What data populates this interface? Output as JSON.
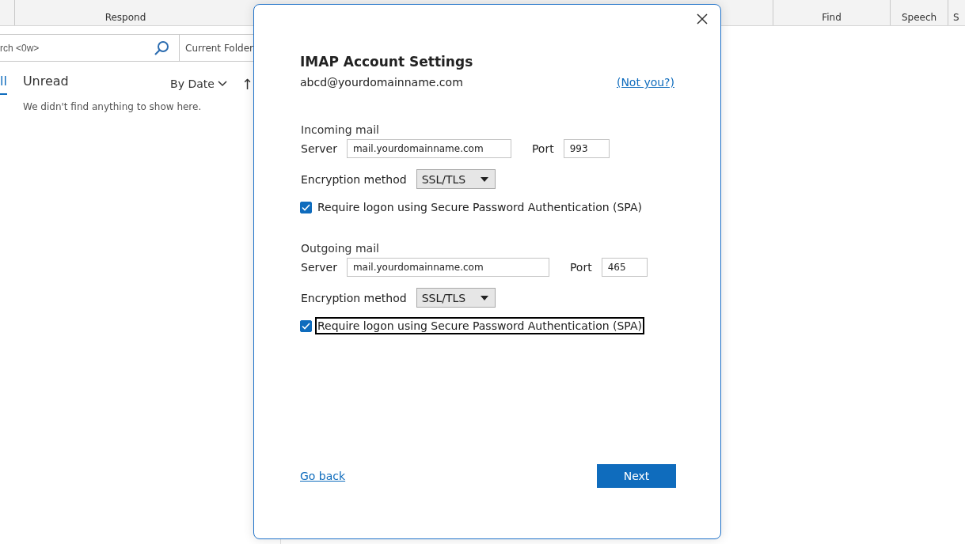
{
  "ribbon": {
    "groups": [
      {
        "label": "Respond"
      },
      {
        "label": "Find"
      },
      {
        "label": "Speech"
      },
      {
        "label": "S"
      }
    ]
  },
  "mail_list": {
    "search": {
      "placeholder": "rch <0w>"
    },
    "scope": "Current Folder",
    "tabs": [
      {
        "label": "ll",
        "selected": true
      },
      {
        "label": "Unread",
        "selected": false
      }
    ],
    "sort": "By Date",
    "sort_direction": "↑",
    "empty_message": "We didn't find anything to show here."
  },
  "dialog": {
    "title": "IMAP Account Settings",
    "account": "abcd@yourdomainname.com",
    "not_you": "(Not you?)",
    "sections": [
      {
        "heading": "Incoming mail",
        "server_label": "Server",
        "server": "mail.yourdomainname.com",
        "port_label": "Port",
        "port": "993",
        "encryption_label": "Encryption method",
        "encryption": "SSL/TLS",
        "spa_label": "Require logon using Secure Password Authentication (SPA)",
        "spa_checked": true,
        "focused": false
      },
      {
        "heading": "Outgoing mail",
        "server_label": "Server",
        "server": "mail.yourdomainname.com",
        "port_label": "Port",
        "port": "465",
        "encryption_label": "Encryption method",
        "encryption": "SSL/TLS",
        "spa_label": "Require logon using Secure Password Authentication (SPA)",
        "spa_checked": true,
        "focused": true
      }
    ],
    "back": "Go back",
    "next": "Next"
  }
}
